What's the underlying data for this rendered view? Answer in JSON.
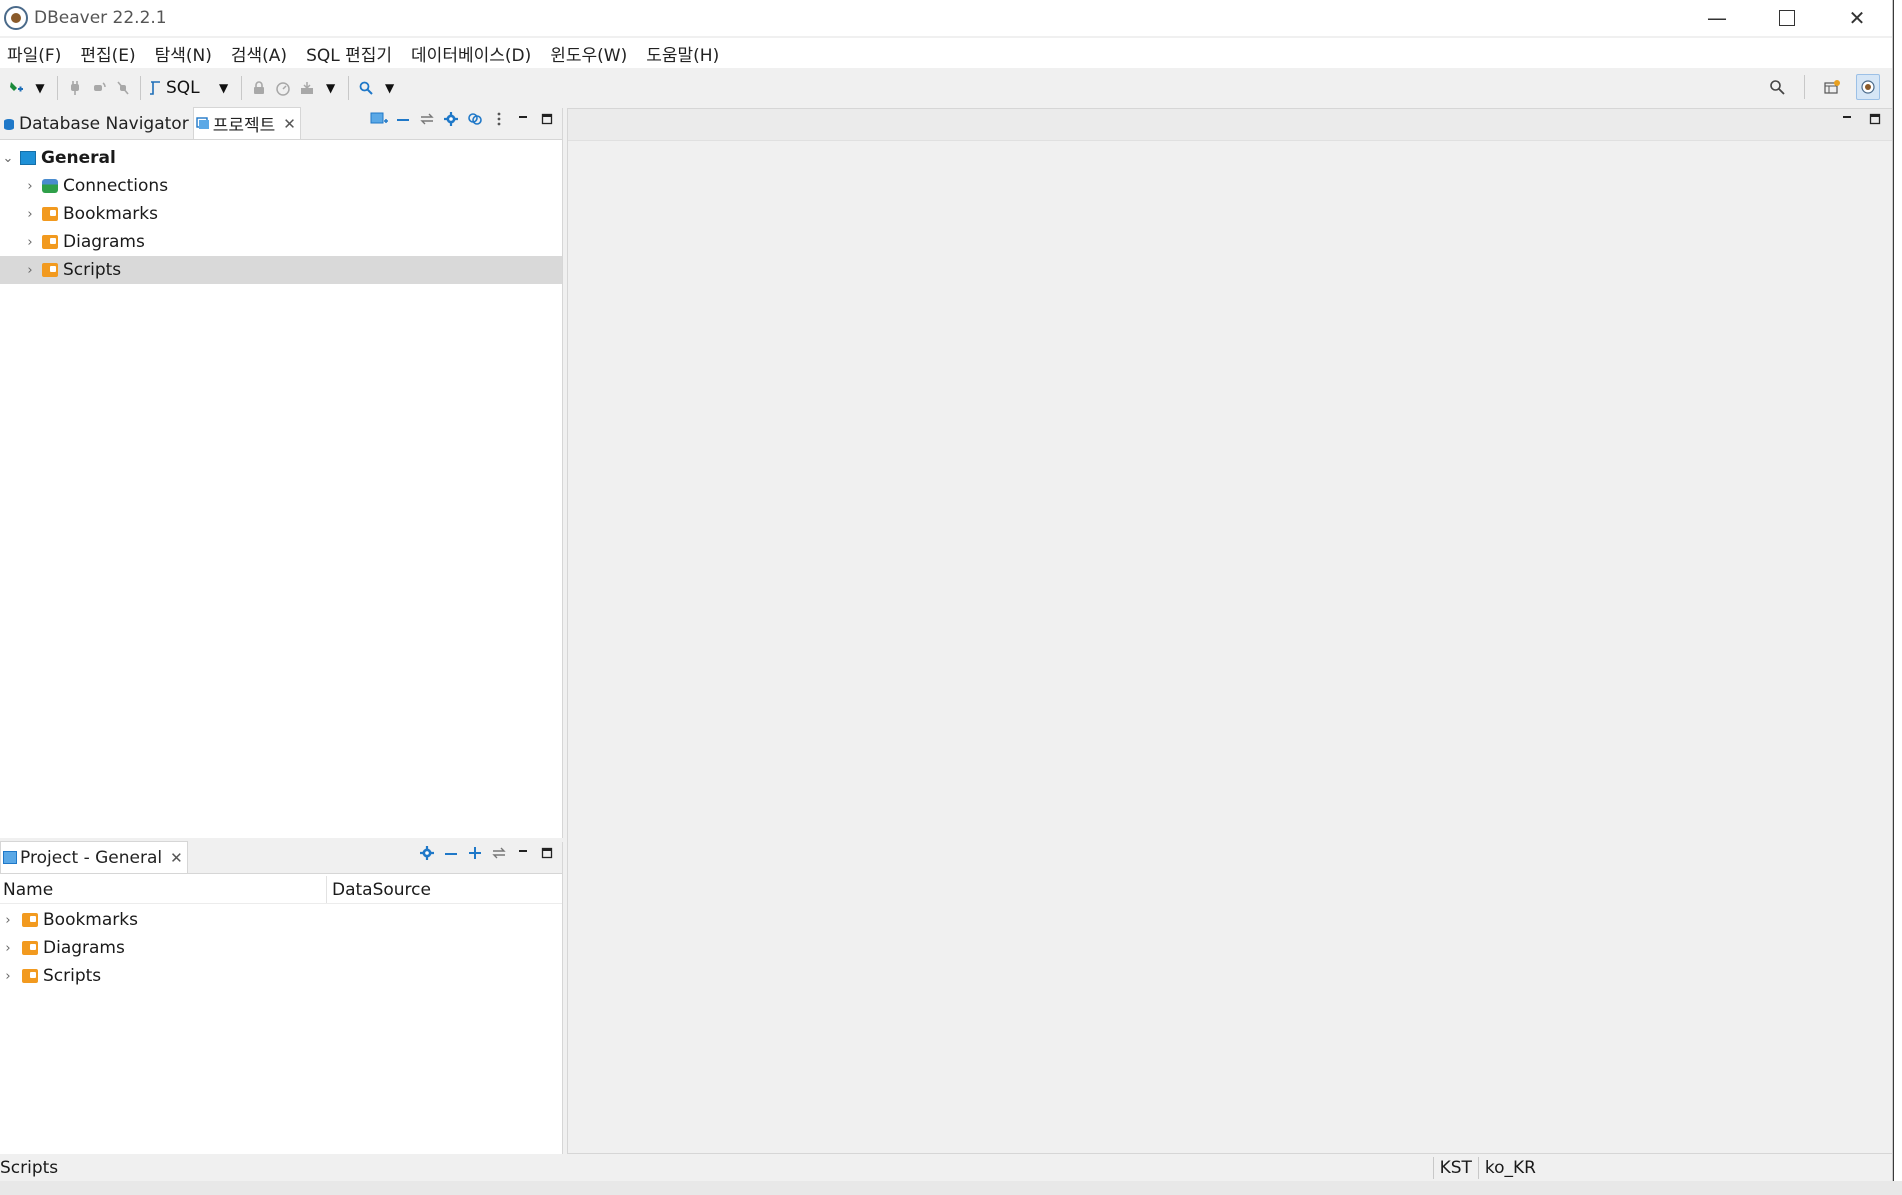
{
  "window": {
    "title": "DBeaver 22.2.1",
    "minimize_glyph": "—",
    "close_glyph": "✕"
  },
  "menu": {
    "items": [
      {
        "label": "파일(F)"
      },
      {
        "label": "편집(E)"
      },
      {
        "label": "탐색(N)"
      },
      {
        "label": "검색(A)"
      },
      {
        "label": "SQL 편집기"
      },
      {
        "label": "데이터베이스(D)"
      },
      {
        "label": "윈도우(W)"
      },
      {
        "label": "도움말(H)"
      }
    ]
  },
  "toolbar": {
    "sql_label": "SQL"
  },
  "nav_panel": {
    "tabs": [
      {
        "label": "Database Navigator",
        "active": false
      },
      {
        "label": "프로젝트",
        "active": true
      }
    ],
    "tree": [
      {
        "label": "General",
        "level": 0,
        "expanded": true,
        "icon": "project-icon"
      },
      {
        "label": "Connections",
        "level": 1,
        "icon": "connections-icon"
      },
      {
        "label": "Bookmarks",
        "level": 1,
        "icon": "bookmarks-folder-icon"
      },
      {
        "label": "Diagrams",
        "level": 1,
        "icon": "diagrams-folder-icon"
      },
      {
        "label": "Scripts",
        "level": 1,
        "icon": "scripts-folder-icon",
        "selected": true
      }
    ]
  },
  "project_panel": {
    "tab_label": "Project - General",
    "columns": [
      "Name",
      "DataSource"
    ],
    "rows": [
      {
        "label": "Bookmarks",
        "icon": "bookmarks-folder-icon"
      },
      {
        "label": "Diagrams",
        "icon": "diagrams-folder-icon"
      },
      {
        "label": "Scripts",
        "icon": "scripts-folder-icon"
      }
    ]
  },
  "status": {
    "text": "Scripts",
    "timezone": "KST",
    "locale": "ko_KR"
  },
  "colors": {
    "accent": "#1f78c8",
    "folder": "#f29a1f",
    "selection": "#d9d9d9"
  }
}
